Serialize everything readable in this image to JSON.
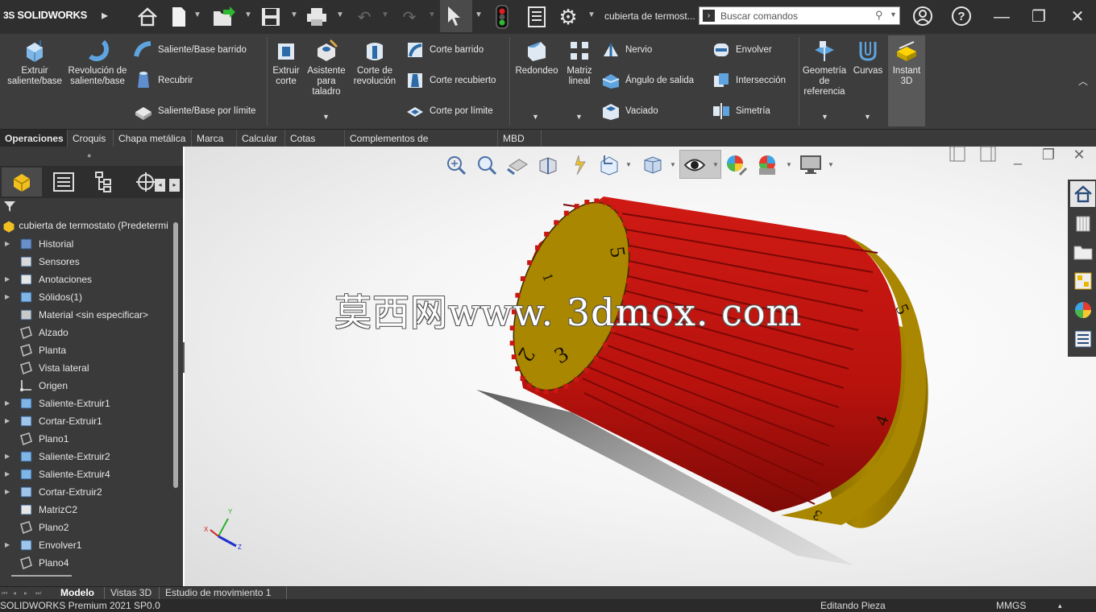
{
  "app": {
    "logo_text": "SOLIDWORKS",
    "document_title": "cubierta de termost...",
    "search_placeholder": "Buscar comandos"
  },
  "colors": {
    "accent": "#ffd400",
    "part_red": "#c8140f",
    "part_gold": "#9e7d00",
    "dark_bg": "#3d3d3d"
  },
  "titlebar": {
    "icons": [
      "home-icon",
      "new-doc-icon",
      "open-icon",
      "save-icon",
      "print-icon",
      "undo-icon",
      "redo-icon",
      "select-pointer-icon",
      "rebuild-traffic-light-icon",
      "file-properties-icon",
      "options-gear-icon"
    ],
    "right_icons": [
      "user-icon",
      "help-icon",
      "restore-icon",
      "close-icon"
    ]
  },
  "ribbon": {
    "big_buttons": [
      {
        "name": "extrude-boss-button",
        "label": "Extruir saliente/base"
      },
      {
        "name": "revolve-boss-button",
        "label": "Revolución de saliente/base"
      },
      {
        "name": "extrude-cut-button",
        "label": "Extruir corte"
      },
      {
        "name": "hole-wizard-button",
        "label": "Asistente para taladro"
      },
      {
        "name": "revolve-cut-button",
        "label": "Corte de revolución"
      },
      {
        "name": "fillet-button",
        "label": "Redondeo"
      },
      {
        "name": "linear-pattern-button",
        "label": "Matriz lineal"
      },
      {
        "name": "reference-geometry-button",
        "label": "Geometría de referencia"
      },
      {
        "name": "curves-button",
        "label": "Curvas"
      },
      {
        "name": "instant3d-button",
        "label": "Instant 3D"
      }
    ],
    "small_buttons": [
      {
        "name": "swept-boss-button",
        "label": "Saliente/Base barrido"
      },
      {
        "name": "loft-boss-button",
        "label": "Recubrir"
      },
      {
        "name": "boundary-boss-button",
        "label": "Saliente/Base por límite"
      },
      {
        "name": "swept-cut-button",
        "label": "Corte barrido"
      },
      {
        "name": "lofted-cut-button",
        "label": "Corte recubierto"
      },
      {
        "name": "boundary-cut-button",
        "label": "Corte por límite"
      },
      {
        "name": "rib-button",
        "label": "Nervio"
      },
      {
        "name": "draft-button",
        "label": "Ángulo de salida"
      },
      {
        "name": "shell-button",
        "label": "Vaciado"
      },
      {
        "name": "wrap-button",
        "label": "Envolver"
      },
      {
        "name": "intersect-button",
        "label": "Intersección"
      },
      {
        "name": "mirror-button",
        "label": "Simetría"
      }
    ]
  },
  "tabs": [
    "Operaciones",
    "Croquis",
    "Chapa metálica",
    "Marca",
    "Calcular",
    "Cotas MBD",
    "Complementos de SOLIDWORKS",
    "MBD"
  ],
  "tree": {
    "root": "cubierta de termostato  (Predetermi",
    "items": [
      {
        "label": "Historial",
        "expand": true,
        "icon": "history-icon"
      },
      {
        "label": "Sensores",
        "expand": false,
        "icon": "sensor-icon"
      },
      {
        "label": "Anotaciones",
        "expand": true,
        "icon": "annotations-icon"
      },
      {
        "label": "Sólidos(1)",
        "expand": true,
        "icon": "solid-bodies-icon"
      },
      {
        "label": "Material <sin especificar>",
        "expand": false,
        "icon": "material-icon"
      },
      {
        "label": "Alzado",
        "expand": false,
        "icon": "plane-icon"
      },
      {
        "label": "Planta",
        "expand": false,
        "icon": "plane-icon"
      },
      {
        "label": "Vista lateral",
        "expand": false,
        "icon": "plane-icon"
      },
      {
        "label": "Origen",
        "expand": false,
        "icon": "origin-icon"
      },
      {
        "label": "Saliente-Extruir1",
        "expand": true,
        "icon": "extrude-feature-icon"
      },
      {
        "label": "Cortar-Extruir1",
        "expand": true,
        "icon": "cut-feature-icon"
      },
      {
        "label": "Plano1",
        "expand": false,
        "icon": "plane-icon"
      },
      {
        "label": "Saliente-Extruir2",
        "expand": true,
        "icon": "extrude-feature-icon"
      },
      {
        "label": "Saliente-Extruir4",
        "expand": true,
        "icon": "extrude-feature-icon"
      },
      {
        "label": "Cortar-Extruir2",
        "expand": true,
        "icon": "cut-feature-icon"
      },
      {
        "label": "MatrizC2",
        "expand": false,
        "icon": "circular-pattern-icon"
      },
      {
        "label": "Plano2",
        "expand": false,
        "icon": "plane-icon"
      },
      {
        "label": "Envolver1",
        "expand": true,
        "icon": "wrap-feature-icon"
      },
      {
        "label": "Plano4",
        "expand": false,
        "icon": "plane-icon"
      }
    ]
  },
  "viewport": {
    "watermark": "莫西网www. 3dmox. com",
    "dial_numbers_front": [
      "5",
      "1",
      "2",
      "3"
    ],
    "dial_numbers_back": [
      "5",
      "4",
      "3"
    ],
    "triad": {
      "x": "X",
      "y": "Y",
      "z": "Z"
    }
  },
  "bottom_tabs": [
    "Modelo",
    "Vistas 3D",
    "Estudio de movimiento 1"
  ],
  "status": {
    "product": "SOLIDWORKS Premium 2021 SP0.0",
    "mode": "Editando Pieza",
    "units": "MMGS",
    "units_caret": "▴"
  }
}
